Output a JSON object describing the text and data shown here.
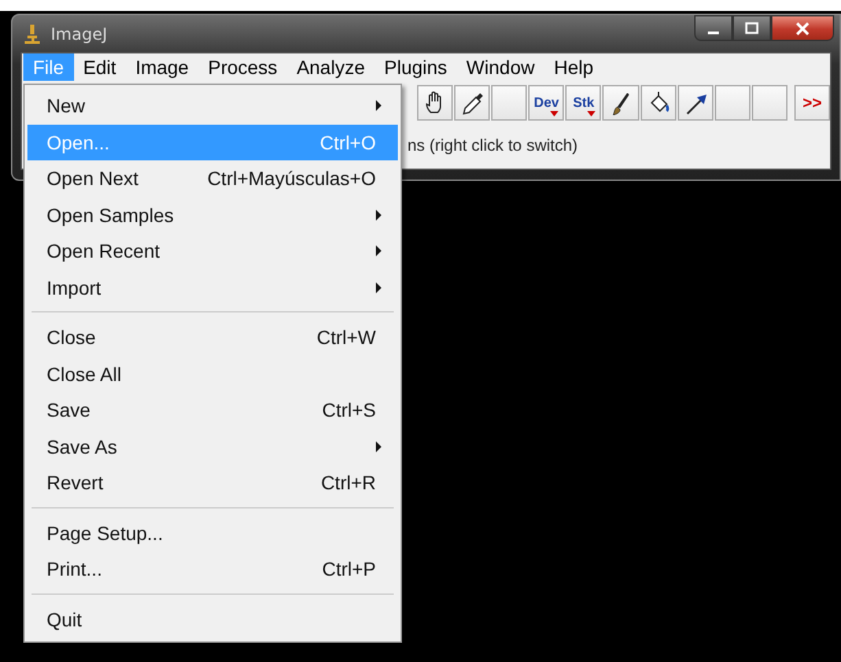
{
  "window": {
    "title": "ImageJ"
  },
  "menu_bar": [
    {
      "label": "File",
      "selected": true
    },
    {
      "label": "Edit",
      "selected": false
    },
    {
      "label": "Image",
      "selected": false
    },
    {
      "label": "Process",
      "selected": false
    },
    {
      "label": "Analyze",
      "selected": false
    },
    {
      "label": "Plugins",
      "selected": false
    },
    {
      "label": "Window",
      "selected": false
    },
    {
      "label": "Help",
      "selected": false
    }
  ],
  "toolbar": [
    {
      "kind": "hand"
    },
    {
      "kind": "dropper"
    },
    {
      "kind": "empty"
    },
    {
      "kind": "text",
      "label": "Dev"
    },
    {
      "kind": "text",
      "label": "Stk"
    },
    {
      "kind": "brush"
    },
    {
      "kind": "bucket"
    },
    {
      "kind": "arrow"
    },
    {
      "kind": "empty"
    },
    {
      "kind": "empty"
    },
    {
      "kind": "more",
      "label": ">>"
    }
  ],
  "status_bar": "ns (right click to switch)",
  "file_menu": [
    {
      "kind": "item",
      "label": "New",
      "submenu": true,
      "selected": false
    },
    {
      "kind": "item",
      "label": "Open...",
      "shortcut": "Ctrl+O",
      "submenu": false,
      "selected": true
    },
    {
      "kind": "item",
      "label": "Open Next",
      "shortcut": "Ctrl+Mayúsculas+O",
      "submenu": false,
      "selected": false
    },
    {
      "kind": "item",
      "label": "Open Samples",
      "submenu": true,
      "selected": false
    },
    {
      "kind": "item",
      "label": "Open Recent",
      "submenu": true,
      "selected": false
    },
    {
      "kind": "item",
      "label": "Import",
      "submenu": true,
      "selected": false
    },
    {
      "kind": "separator"
    },
    {
      "kind": "item",
      "label": "Close",
      "shortcut": "Ctrl+W",
      "submenu": false,
      "selected": false
    },
    {
      "kind": "item",
      "label": "Close All",
      "submenu": false,
      "selected": false
    },
    {
      "kind": "item",
      "label": "Save",
      "shortcut": "Ctrl+S",
      "submenu": false,
      "selected": false
    },
    {
      "kind": "item",
      "label": "Save As",
      "submenu": true,
      "selected": false
    },
    {
      "kind": "item",
      "label": "Revert",
      "shortcut": "Ctrl+R",
      "submenu": false,
      "selected": false
    },
    {
      "kind": "separator"
    },
    {
      "kind": "item",
      "label": "Page Setup...",
      "submenu": false,
      "selected": false
    },
    {
      "kind": "item",
      "label": "Print...",
      "shortcut": "Ctrl+P",
      "submenu": false,
      "selected": false
    },
    {
      "kind": "separator"
    },
    {
      "kind": "item",
      "label": "Quit",
      "submenu": false,
      "selected": false
    }
  ]
}
